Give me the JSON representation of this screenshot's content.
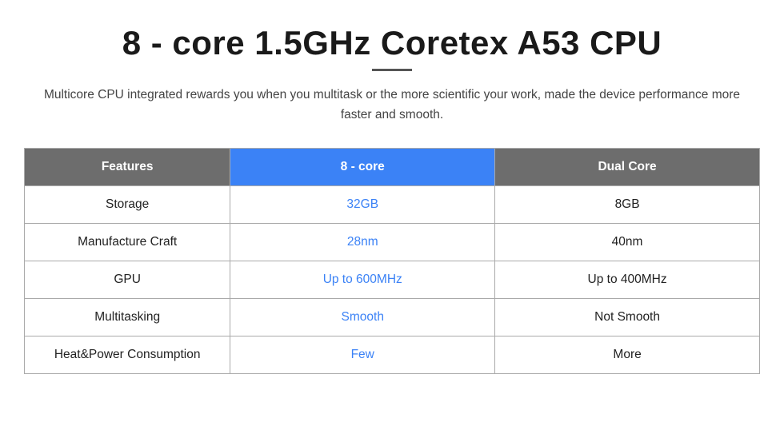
{
  "title": "8 - core 1.5GHz Coretex A53 CPU",
  "subtitle": "Multicore CPU integrated rewards you when you multitask or the more scientific your work, made the device performance more faster and smooth.",
  "table": {
    "headers": {
      "features": "Features",
      "col1": "8 - core",
      "col2": "Dual Core"
    },
    "rows": [
      {
        "feature": "Storage",
        "col1": "32GB",
        "col2": "8GB"
      },
      {
        "feature": "Manufacture Craft",
        "col1": "28nm",
        "col2": "40nm"
      },
      {
        "feature": "GPU",
        "col1": "Up to 600MHz",
        "col2": "Up to 400MHz"
      },
      {
        "feature": "Multitasking",
        "col1": "Smooth",
        "col2": "Not Smooth"
      },
      {
        "feature": "Heat&Power Consumption",
        "col1": "Few",
        "col2": "More"
      }
    ]
  }
}
